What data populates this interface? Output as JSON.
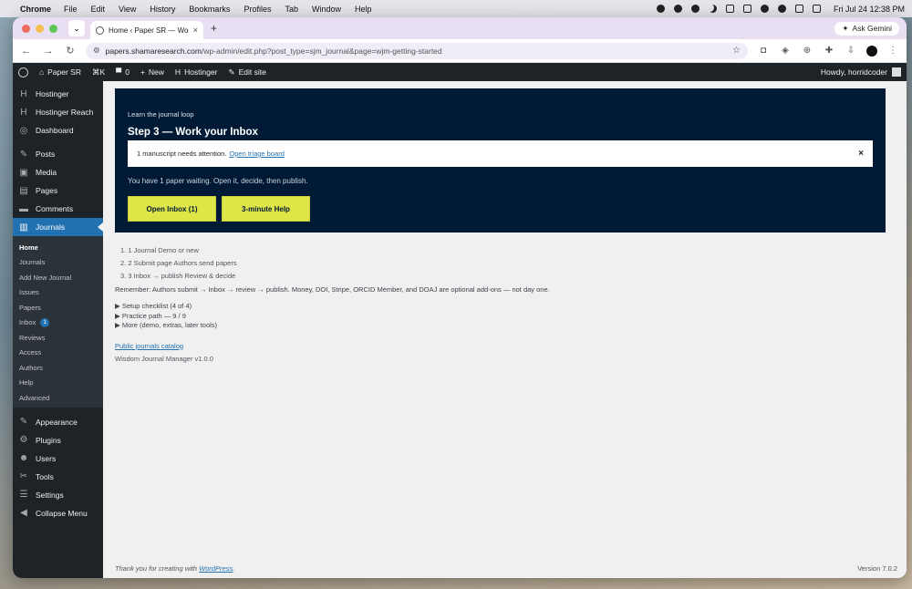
{
  "menubar": {
    "app": "Chrome",
    "items": [
      "File",
      "Edit",
      "View",
      "History",
      "Bookmarks",
      "Profiles",
      "Tab",
      "Window",
      "Help"
    ],
    "clock": "Fri Jul 24  12:38 PM"
  },
  "browser": {
    "tab_title": "Home ‹ Paper SR — WordPress",
    "ask_gemini": "Ask Gemini",
    "url_host": "papers.shamaresearch.com",
    "url_path": "/wp-admin/edit.php?post_type=sjm_journal&page=wjm-getting-started"
  },
  "adminbar": {
    "site": "Paper SR",
    "shortcut": "⌘K",
    "comments": "0",
    "new": "New",
    "hostinger": "Hostinger",
    "edit_site": "Edit site",
    "howdy": "Howdy, horridcoder"
  },
  "sidebar": {
    "top": [
      {
        "label": "Hostinger",
        "icon": "H"
      },
      {
        "label": "Hostinger Reach",
        "icon": "H"
      },
      {
        "label": "Dashboard",
        "icon": "◎"
      }
    ],
    "mid": [
      {
        "label": "Posts",
        "icon": "✎"
      },
      {
        "label": "Media",
        "icon": "▣"
      },
      {
        "label": "Pages",
        "icon": "▤"
      },
      {
        "label": "Comments",
        "icon": "▬"
      },
      {
        "label": "Journals",
        "icon": "▥"
      }
    ],
    "submenu": [
      {
        "label": "Home"
      },
      {
        "label": "Journals"
      },
      {
        "label": "Add New Journal"
      },
      {
        "label": "Issues"
      },
      {
        "label": "Papers"
      },
      {
        "label": "Inbox",
        "badge": "1"
      },
      {
        "label": "Reviews"
      },
      {
        "label": "Access"
      },
      {
        "label": "Authors"
      },
      {
        "label": "Help"
      },
      {
        "label": "Advanced"
      }
    ],
    "bottom": [
      {
        "label": "Appearance",
        "icon": "✎"
      },
      {
        "label": "Plugins",
        "icon": "⚙"
      },
      {
        "label": "Users",
        "icon": "☻"
      },
      {
        "label": "Tools",
        "icon": "✂"
      },
      {
        "label": "Settings",
        "icon": "☰"
      },
      {
        "label": "Collapse Menu",
        "icon": "◀"
      }
    ]
  },
  "hero": {
    "kicker": "Learn the journal loop",
    "title": "Step 3 — Work your Inbox",
    "notice_text": "1 manuscript needs attention.",
    "notice_link": "Open triage board",
    "close": "×",
    "desc": "You have 1 paper waiting. Open it, decide, then publish.",
    "btn_inbox": "Open Inbox (1)",
    "btn_help": "3-minute Help"
  },
  "steps": [
    "1. 1 Journal Demo or new",
    "2. 2 Submit page Authors send papers",
    "3. 3 Inbox → publish Review & decide"
  ],
  "remember": "Remember: Authors submit → Inbox → review → publish. Money, DOI, Stripe, ORCID Member, and DOAJ are optional add-ons — not day one.",
  "details": [
    "▶ Setup checklist (4 of 4)",
    "▶ Practice path — 9 / 9",
    "▶ More (demo, extras, later tools)"
  ],
  "catalog_link": "Public journals catalog",
  "plugin_version": "Wisdom Journal Manager v1.0.0",
  "footer": {
    "thanks": "Thank you for creating with",
    "wp_link": "WordPress",
    "period": ".",
    "version": "Version 7.0.2"
  }
}
